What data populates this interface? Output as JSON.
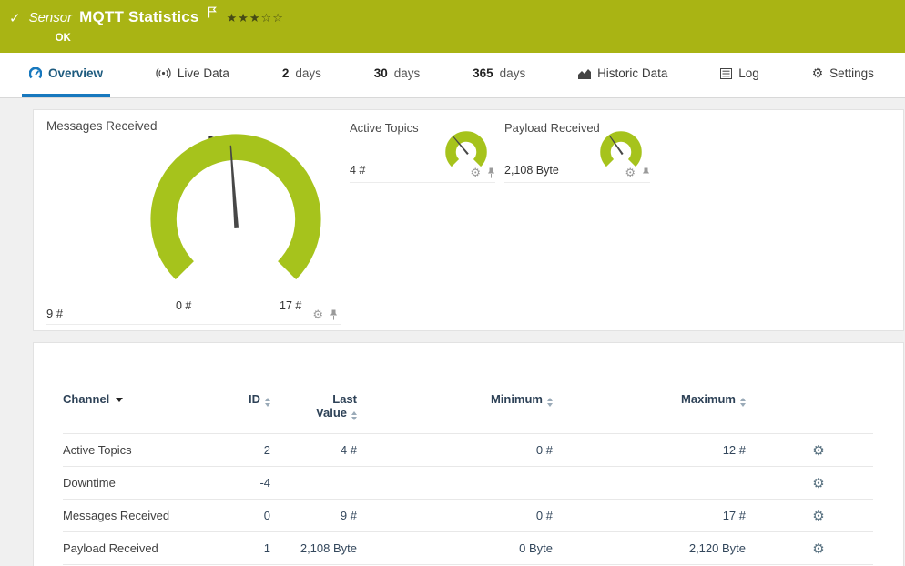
{
  "colors": {
    "header_bg": "#a9b414",
    "gauge_green": "#a6c31c",
    "accent_blue": "#1778be",
    "table_header_text": "#2e4257",
    "value_text": "#33475c"
  },
  "header": {
    "kind_label": "Sensor",
    "title": "MQTT Statistics",
    "status": "OK",
    "priority_stars": "★★★☆☆"
  },
  "tabs": {
    "items": [
      {
        "num": "",
        "label": "Overview"
      },
      {
        "num": "",
        "label": "Live Data"
      },
      {
        "num": "2",
        "label": "days"
      },
      {
        "num": "30",
        "label": "days"
      },
      {
        "num": "365",
        "label": "days"
      },
      {
        "num": "",
        "label": "Historic Data"
      },
      {
        "num": "",
        "label": "Log"
      },
      {
        "num": "",
        "label": "Settings"
      }
    ]
  },
  "gauges": {
    "primary": {
      "title": "Messages Received",
      "value": "9 #",
      "scale_min": "0 #",
      "scale_max": "17 #"
    },
    "small": [
      {
        "title": "Active Topics",
        "value": "4 #"
      },
      {
        "title": "Payload Received",
        "value": "2,108 Byte"
      }
    ]
  },
  "table": {
    "headers": {
      "channel": "Channel",
      "id": "ID",
      "last_value_line1": "Last",
      "last_value_line2": "Value",
      "minimum": "Minimum",
      "maximum": "Maximum"
    },
    "rows": [
      {
        "channel": "Active Topics",
        "id": "2",
        "last_value": "4 #",
        "minimum": "0 #",
        "maximum": "12 #"
      },
      {
        "channel": "Downtime",
        "id": "-4",
        "last_value": "",
        "minimum": "",
        "maximum": ""
      },
      {
        "channel": "Messages Received",
        "id": "0",
        "last_value": "9 #",
        "minimum": "0 #",
        "maximum": "17 #"
      },
      {
        "channel": "Payload Received",
        "id": "1",
        "last_value": "2,108 Byte",
        "minimum": "0 Byte",
        "maximum": "2,120 Byte"
      }
    ]
  },
  "chart_data": [
    {
      "type": "gauge",
      "title": "Messages Received",
      "value": 9,
      "unit": "#",
      "scale_min": 0,
      "scale_max": 17
    },
    {
      "type": "gauge",
      "title": "Active Topics",
      "value": 4,
      "unit": "#"
    },
    {
      "type": "gauge",
      "title": "Payload Received",
      "value": 2108,
      "unit": "Byte"
    }
  ]
}
